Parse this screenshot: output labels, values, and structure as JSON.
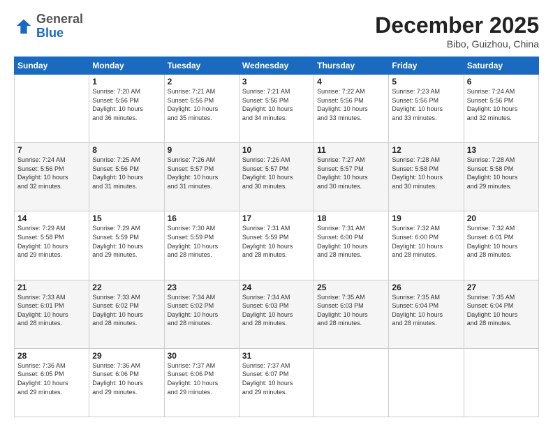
{
  "header": {
    "logo": {
      "general": "General",
      "blue": "Blue"
    },
    "title": "December 2025",
    "location": "Bibo, Guizhou, China"
  },
  "days_of_week": [
    "Sunday",
    "Monday",
    "Tuesday",
    "Wednesday",
    "Thursday",
    "Friday",
    "Saturday"
  ],
  "weeks": [
    [
      {
        "day": "",
        "info": ""
      },
      {
        "day": "1",
        "info": "Sunrise: 7:20 AM\nSunset: 5:56 PM\nDaylight: 10 hours\nand 36 minutes."
      },
      {
        "day": "2",
        "info": "Sunrise: 7:21 AM\nSunset: 5:56 PM\nDaylight: 10 hours\nand 35 minutes."
      },
      {
        "day": "3",
        "info": "Sunrise: 7:21 AM\nSunset: 5:56 PM\nDaylight: 10 hours\nand 34 minutes."
      },
      {
        "day": "4",
        "info": "Sunrise: 7:22 AM\nSunset: 5:56 PM\nDaylight: 10 hours\nand 33 minutes."
      },
      {
        "day": "5",
        "info": "Sunrise: 7:23 AM\nSunset: 5:56 PM\nDaylight: 10 hours\nand 33 minutes."
      },
      {
        "day": "6",
        "info": "Sunrise: 7:24 AM\nSunset: 5:56 PM\nDaylight: 10 hours\nand 32 minutes."
      }
    ],
    [
      {
        "day": "7",
        "info": "Sunrise: 7:24 AM\nSunset: 5:56 PM\nDaylight: 10 hours\nand 32 minutes."
      },
      {
        "day": "8",
        "info": "Sunrise: 7:25 AM\nSunset: 5:56 PM\nDaylight: 10 hours\nand 31 minutes."
      },
      {
        "day": "9",
        "info": "Sunrise: 7:26 AM\nSunset: 5:57 PM\nDaylight: 10 hours\nand 31 minutes."
      },
      {
        "day": "10",
        "info": "Sunrise: 7:26 AM\nSunset: 5:57 PM\nDaylight: 10 hours\nand 30 minutes."
      },
      {
        "day": "11",
        "info": "Sunrise: 7:27 AM\nSunset: 5:57 PM\nDaylight: 10 hours\nand 30 minutes."
      },
      {
        "day": "12",
        "info": "Sunrise: 7:28 AM\nSunset: 5:58 PM\nDaylight: 10 hours\nand 30 minutes."
      },
      {
        "day": "13",
        "info": "Sunrise: 7:28 AM\nSunset: 5:58 PM\nDaylight: 10 hours\nand 29 minutes."
      }
    ],
    [
      {
        "day": "14",
        "info": "Sunrise: 7:29 AM\nSunset: 5:58 PM\nDaylight: 10 hours\nand 29 minutes."
      },
      {
        "day": "15",
        "info": "Sunrise: 7:29 AM\nSunset: 5:59 PM\nDaylight: 10 hours\nand 29 minutes."
      },
      {
        "day": "16",
        "info": "Sunrise: 7:30 AM\nSunset: 5:59 PM\nDaylight: 10 hours\nand 28 minutes."
      },
      {
        "day": "17",
        "info": "Sunrise: 7:31 AM\nSunset: 5:59 PM\nDaylight: 10 hours\nand 28 minutes."
      },
      {
        "day": "18",
        "info": "Sunrise: 7:31 AM\nSunset: 6:00 PM\nDaylight: 10 hours\nand 28 minutes."
      },
      {
        "day": "19",
        "info": "Sunrise: 7:32 AM\nSunset: 6:00 PM\nDaylight: 10 hours\nand 28 minutes."
      },
      {
        "day": "20",
        "info": "Sunrise: 7:32 AM\nSunset: 6:01 PM\nDaylight: 10 hours\nand 28 minutes."
      }
    ],
    [
      {
        "day": "21",
        "info": "Sunrise: 7:33 AM\nSunset: 6:01 PM\nDaylight: 10 hours\nand 28 minutes."
      },
      {
        "day": "22",
        "info": "Sunrise: 7:33 AM\nSunset: 6:02 PM\nDaylight: 10 hours\nand 28 minutes."
      },
      {
        "day": "23",
        "info": "Sunrise: 7:34 AM\nSunset: 6:02 PM\nDaylight: 10 hours\nand 28 minutes."
      },
      {
        "day": "24",
        "info": "Sunrise: 7:34 AM\nSunset: 6:03 PM\nDaylight: 10 hours\nand 28 minutes."
      },
      {
        "day": "25",
        "info": "Sunrise: 7:35 AM\nSunset: 6:03 PM\nDaylight: 10 hours\nand 28 minutes."
      },
      {
        "day": "26",
        "info": "Sunrise: 7:35 AM\nSunset: 6:04 PM\nDaylight: 10 hours\nand 28 minutes."
      },
      {
        "day": "27",
        "info": "Sunrise: 7:35 AM\nSunset: 6:04 PM\nDaylight: 10 hours\nand 28 minutes."
      }
    ],
    [
      {
        "day": "28",
        "info": "Sunrise: 7:36 AM\nSunset: 6:05 PM\nDaylight: 10 hours\nand 29 minutes."
      },
      {
        "day": "29",
        "info": "Sunrise: 7:36 AM\nSunset: 6:06 PM\nDaylight: 10 hours\nand 29 minutes."
      },
      {
        "day": "30",
        "info": "Sunrise: 7:37 AM\nSunset: 6:06 PM\nDaylight: 10 hours\nand 29 minutes."
      },
      {
        "day": "31",
        "info": "Sunrise: 7:37 AM\nSunset: 6:07 PM\nDaylight: 10 hours\nand 29 minutes."
      },
      {
        "day": "",
        "info": ""
      },
      {
        "day": "",
        "info": ""
      },
      {
        "day": "",
        "info": ""
      }
    ]
  ]
}
